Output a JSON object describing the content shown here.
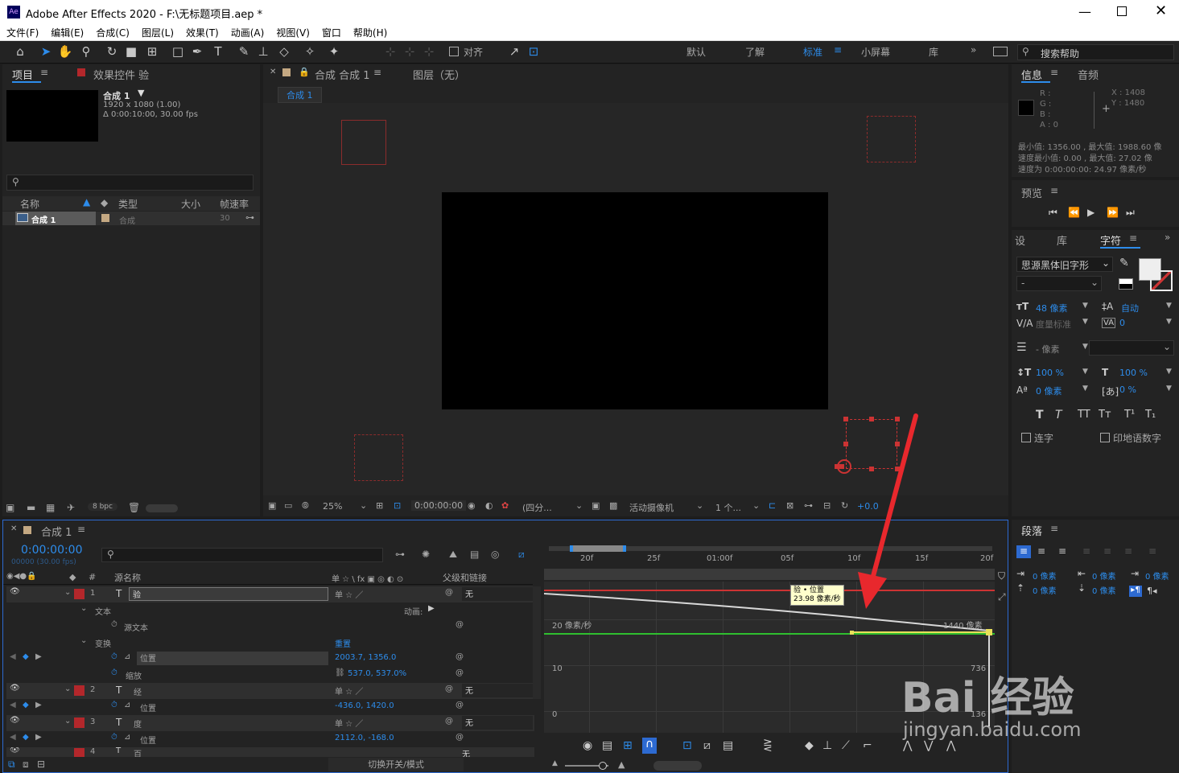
{
  "window": {
    "title": "Adobe After Effects 2020 - F:\\无标题项目.aep *",
    "app_icon": "Ae"
  },
  "menu": [
    "文件(F)",
    "编辑(E)",
    "合成(C)",
    "图层(L)",
    "效果(T)",
    "动画(A)",
    "视图(V)",
    "窗口",
    "帮助(H)"
  ],
  "toolbar": {
    "align_label": "对齐",
    "workspaces": [
      "默认",
      "了解",
      "标准",
      "小屏幕",
      "库"
    ],
    "active_workspace": "标准",
    "search_placeholder": "搜索帮助"
  },
  "project_panel": {
    "tab": "项目",
    "effects_tab": "效果控件 验",
    "comp_name": "合成 1",
    "comp_size": "1920 x 1080 (1.00)",
    "comp_duration": "Δ 0:00:10:00, 30.00 fps",
    "columns": [
      "名称",
      "类型",
      "大小",
      "帧速率"
    ],
    "items": [
      {
        "name": "合成 1",
        "type": "合成",
        "fps": "30"
      }
    ],
    "bpc": "8 bpc"
  },
  "comp_panel": {
    "tab": "合成 合成 1",
    "layer_tab": "图层（无）",
    "sub_tab": "合成 1",
    "zoom": "25%",
    "time": "0:00:00:00",
    "resolution": "(四分...",
    "camera": "活动摄像机",
    "views": "1 个...",
    "exposure": "+0.0"
  },
  "info_panel": {
    "tab": "信息",
    "audio_tab": "音频",
    "r": "R :",
    "g": "G :",
    "b": "B :",
    "a": "A :  0",
    "x": "X : 1408",
    "y": "Y : 1480",
    "line1": "最小值: 1356.00 , 最大值: 1988.60 像",
    "line2": "速度最小值: 0.00 , 最大值: 27.02 像",
    "line3": "速度为 0:00:00:00: 24.97 像素/秒"
  },
  "preview_panel": {
    "tab": "预览"
  },
  "char_panel": {
    "tabs": [
      "设",
      "库",
      "字符"
    ],
    "font": "思源黑体旧字形",
    "style": "-",
    "size": "48 像素",
    "leading": "自动",
    "kerning": "度量标准",
    "tracking": "0",
    "stroke": "- 像素",
    "vscale": "100 %",
    "hscale": "100 %",
    "baseline": "0 像素",
    "tsume": "0 %",
    "ligature": "连字",
    "hindi": "印地语数字"
  },
  "para_panel": {
    "tab": "段落",
    "indent_left": "0 像素",
    "indent_right": "0 像素",
    "indent_first": "0 像素",
    "space_before": "0 像素",
    "space_after": "0 像素"
  },
  "timeline": {
    "tab": "合成 1",
    "timecode": "0:00:00:00",
    "frames": "00000 (30.00 fps)",
    "col_name": "源名称",
    "col_parent": "父级和链接",
    "switches": "单 ☆ \\ fx ▣ ◎ ◐ ⊙",
    "layers": [
      {
        "num": "1",
        "type": "T",
        "name": "验",
        "parent": "无"
      },
      {
        "label": "文本",
        "animate": "动画:"
      },
      {
        "label": "源文本"
      },
      {
        "label": "变换",
        "reset": "重置"
      },
      {
        "label": "位置",
        "value": "2003.7, 1356.0"
      },
      {
        "label": "缩放",
        "value": "537.0, 537.0%"
      },
      {
        "num": "2",
        "type": "T",
        "name": "经",
        "parent": "无"
      },
      {
        "label": "位置",
        "value": "-436.0, 1420.0"
      },
      {
        "num": "3",
        "type": "T",
        "name": "度",
        "parent": "无"
      },
      {
        "label": "位置",
        "value": "2112.0, -168.0"
      },
      {
        "num": "4",
        "type": "T",
        "name": "百",
        "parent": "无"
      }
    ],
    "toggle_mode": "切换开关/模式",
    "ruler": [
      "20f",
      "25f",
      "01:00f",
      "05f",
      "10f",
      "15f",
      "20f"
    ],
    "graph_labels": {
      "y20": "20 像素/秒",
      "y10": "10",
      "y0": "0",
      "right1": "1440 像素",
      "right2": "736",
      "right3": "136"
    },
    "tooltip_line1": "验 • 位置",
    "tooltip_line2": "23.98 像素/秒"
  },
  "watermark": {
    "text": "Bai 经验",
    "url": "jingyan.baidu.com"
  }
}
